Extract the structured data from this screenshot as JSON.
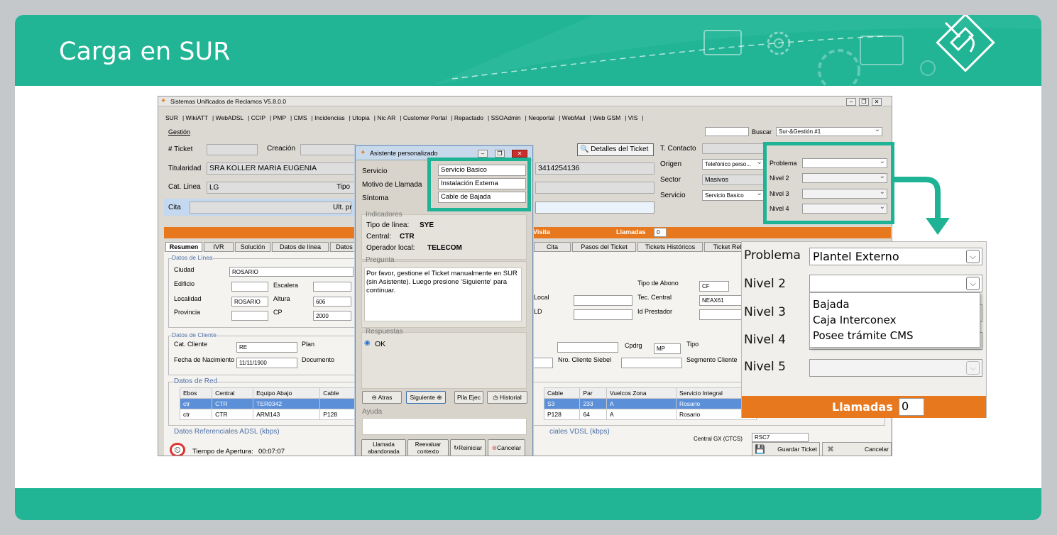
{
  "slide_title": "Carga en SUR",
  "colors": {
    "accent": "#21b495",
    "highlight": "#1db394",
    "orange": "#e8781e"
  },
  "app": {
    "title": "Sistemas Unificados de Reclamos V5.8.0.0",
    "menu": [
      "SUR",
      "WikiATT",
      "WebADSL",
      "CCIP",
      "PMP",
      "CMS",
      "Incidencias",
      "Utopia",
      "Nic AR",
      "Customer Portal",
      "Repactado",
      "SSOAdmin",
      "Neoportal",
      "WebMail",
      "Web GSM",
      "VIS"
    ],
    "gestion": "Gestión",
    "buscar_label": "Buscar",
    "buscar_value": "Sur-&Gestión #1",
    "ticket_label": "# Ticket",
    "creacion_label": "Creación",
    "detalles_button": "Detalles del Ticket",
    "titularidad_label": "Titularidad",
    "titularidad_value": "SRA KOLLER MARIA EUGENIA",
    "phone": "3414254136",
    "cat_linea_label": "Cat. Linea",
    "cat_linea_value": "LG",
    "tipo_label": "Tipo",
    "cita_label": "Cita",
    "ult_label": "Ult. pr",
    "t_contacto_label": "T. Contacto",
    "origen_label": "Origen",
    "origen_value": "Telefónico perso...",
    "sector_label": "Sector",
    "sector_value": "Masivos",
    "servicio_label": "Servicio",
    "servicio_value": "Servicio Basico",
    "problema_label": "Problema",
    "nivel2_label": "Nivel 2",
    "nivel3_label": "Nivel 3",
    "nivel4_label": "Nivel 4",
    "visita_label": "Visita",
    "llamadas_label": "Llamadas",
    "llamadas_value": "0",
    "tabs_left": [
      "Resumen",
      "IVR",
      "Solución",
      "Datos de línea",
      "Datos"
    ],
    "tabs_right": [
      "Cita",
      "Pasos del Ticket",
      "Tickets Históricos",
      "Ticket Rela"
    ],
    "datos_linea_title": "Datos de Línea",
    "ciudad_label": "Ciudad",
    "ciudad_value": "ROSARIO",
    "edificio_label": "Edificio",
    "escalera_label": "Escalera",
    "localidad_label": "Localidad",
    "localidad_value": "ROSARIO",
    "altura_label": "Altura",
    "altura_value": "606",
    "provincia_label": "Provincia",
    "cp_label": "CP",
    "cp_value": "2000",
    "tipo_abono_label": "Tipo de Abono",
    "tipo_abono_value": "CF",
    "local_label": "Local",
    "tec_central_label": "Tec. Central",
    "tec_central_value": "NEAX61",
    "ld_label": "LD",
    "id_prestador_label": "Id Prestador",
    "datos_cliente_title": "Datos de Cliente",
    "cat_cliente_label": "Cat. Cliente",
    "cat_cliente_value": "RE",
    "plan_label": "Plan",
    "cpdrg_label": "Cpdrg",
    "cpdrg_value": "MP",
    "tipo2_label": "Tipo",
    "fecha_nac_label": "Fecha de Nacimiento",
    "fecha_nac_value": "11/11/1900",
    "documento_label": "Documento",
    "nro_cliente_label": "Nro. Cliente Siebel",
    "segmento_label": "Segmento Cliente",
    "datos_red_title": "Datos de Red",
    "red_left_headers": [
      "Ebos",
      "Central",
      "Equipo Abajo",
      "Cable"
    ],
    "red_left_rows": [
      [
        "ctr",
        "CTR",
        "TER0342",
        ""
      ],
      [
        "ctr",
        "CTR",
        "ARM143",
        "P128"
      ]
    ],
    "red_right_headers": [
      "Cable",
      "Par",
      "Vuelcos Zona",
      "Servicio Integral"
    ],
    "red_right_rows": [
      [
        "S3",
        "233",
        "A",
        "Rosario"
      ],
      [
        "P128",
        "64",
        "A",
        "Rosario"
      ]
    ],
    "adsl_label": "Datos Referenciales ADSL (kbps)",
    "vdsl_label": "ciales VDSL (kbps)",
    "central_gx_label": "Central GX (CTCS)",
    "central_gx_value": "RSC7",
    "tiempo_label": "Tiempo de Apertura:",
    "tiempo_value": "00:07:07",
    "guardar_button": "Guardar Ticket",
    "cancelar_button": "Cancelar"
  },
  "dialog": {
    "title": "Asistente personalizado",
    "servicio_label": "Servicio",
    "servicio_value": "Servicio Basico",
    "motivo_label": "Motivo de Llamada",
    "motivo_value": "Instalación Externa",
    "sintoma_label": "Síntoma",
    "sintoma_value": "Cable de Bajada",
    "indicadores_title": "Indicadores",
    "tipo_linea_label": "Tipo de línea:",
    "tipo_linea_value": "SYE",
    "central_label": "Central:",
    "central_value": "CTR",
    "operador_label": "Operador local:",
    "operador_value": "TELECOM",
    "pregunta_title": "Pregunta",
    "pregunta_text": "Por favor, gestione el Ticket manualmente en SUR (sin Asistente). Luego presione 'Siguiente' para continuar.",
    "respuestas_title": "Respuestas",
    "respuesta_ok": "OK",
    "atras": "Atras",
    "siguiente": "Siguiente",
    "pila_ejec": "Pila Ejec",
    "historial": "Historial",
    "ayuda_title": "Ayuda",
    "llamada_abandonada": "Llamada abandonada",
    "reevaluar": "Reevaluar contexto",
    "reiniciar": "Reiniciar",
    "cancelar": "Cancelar"
  },
  "zoom": {
    "problema_label": "Problema",
    "problema_value": "Plantel Externo",
    "nivel2_label": "Nivel 2",
    "nivel3_label": "Nivel 3",
    "nivel4_label": "Nivel 4",
    "nivel5_label": "Nivel 5",
    "options": [
      "Bajada",
      "Caja Interconex",
      "Posee trámite CMS"
    ],
    "llamadas_label": "Llamadas",
    "llamadas_value": "0"
  }
}
